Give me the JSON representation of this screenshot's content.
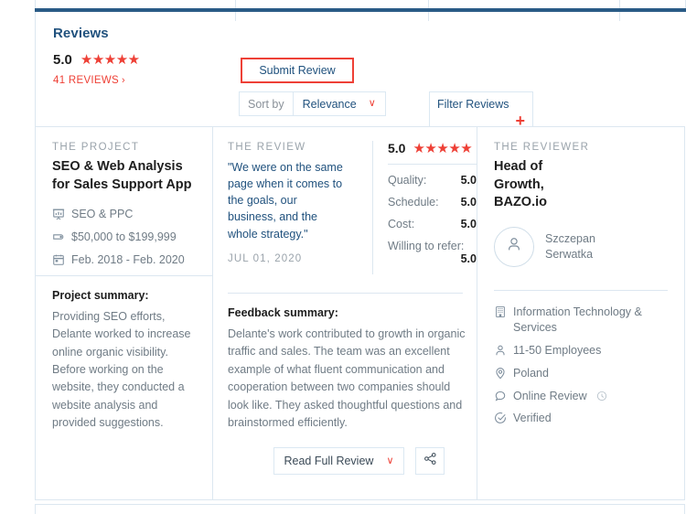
{
  "colors": {
    "accent_red": "#ee4036",
    "brand_blue": "#21527e",
    "rule": "#dce7f0",
    "muted": "#6f7b85"
  },
  "reviews_header": {
    "title": "Reviews",
    "score": "5.0",
    "stars": 5,
    "count_label": "41 REVIEWS",
    "count_chevron": "›",
    "submit_label": "Submit Review",
    "sort_label": "Sort by",
    "sort_value": "Relevance",
    "sort_caret": "∨",
    "filter_label": "Filter Reviews",
    "filter_plus": "+"
  },
  "card": {
    "project": {
      "kicker": "THE PROJECT",
      "title": "SEO & Web Analysis for Sales Support App",
      "meta": [
        {
          "icon": "presentation-chart-icon",
          "text": "SEO & PPC"
        },
        {
          "icon": "price-tag-icon",
          "text": "$50,000 to $199,999"
        },
        {
          "icon": "calendar-icon",
          "text": "Feb. 2018 - Feb. 2020"
        }
      ],
      "summary_title": "Project summary:",
      "summary_body": "Providing SEO efforts, Delante worked to increase online organic visibility. Before working on the website, they conducted a website analysis and provided suggestions."
    },
    "review": {
      "kicker": "THE REVIEW",
      "quote": "\"We were on the same page when it comes to the goals, our business, and the whole strategy.\"",
      "date": "JUL 01, 2020",
      "overall_score": "5.0",
      "overall_stars": 5,
      "ratings": [
        {
          "label": "Quality:",
          "value": "5.0"
        },
        {
          "label": "Schedule:",
          "value": "5.0"
        },
        {
          "label": "Cost:",
          "value": "5.0"
        },
        {
          "label": "Willing to refer:",
          "value": "5.0"
        }
      ],
      "feedback_title": "Feedback summary:",
      "feedback_body": "Delante's work contributed to growth in organic traffic and sales. The team was an excellent example of what fluent communication and cooperation between two companies should look like. They asked thoughtful questions and brainstormed efficiently.",
      "read_full_label": "Read Full Review",
      "read_full_caret": "∨",
      "share_icon": "share-icon"
    },
    "reviewer": {
      "kicker": "THE REVIEWER",
      "title": "Head of Growth, BAZO.io",
      "avatar_icon": "person-avatar-icon",
      "name": "Szczepan Serwatka",
      "facts": [
        {
          "icon": "building-icon",
          "text": "Information Technology & Services"
        },
        {
          "icon": "person-icon",
          "text": "11-50 Employees"
        },
        {
          "icon": "location-pin-icon",
          "text": "Poland"
        },
        {
          "icon": "speech-bubble-icon",
          "text": "Online Review",
          "badge_icon": "clock-badge-icon"
        },
        {
          "icon": "check-circle-icon",
          "text": "Verified"
        }
      ]
    }
  }
}
